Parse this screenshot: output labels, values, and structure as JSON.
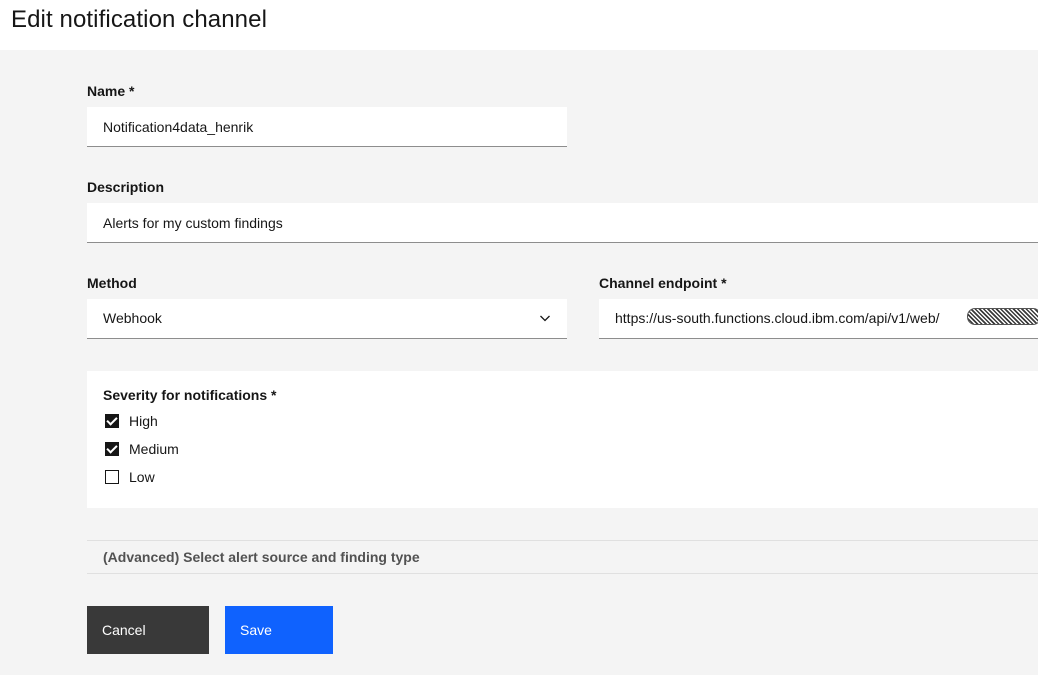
{
  "header": {
    "title": "Edit notification channel"
  },
  "form": {
    "name": {
      "label": "Name *",
      "value": "Notification4data_henrik"
    },
    "description": {
      "label": "Description",
      "value": "Alerts for my custom findings"
    },
    "method": {
      "label": "Method",
      "value": "Webhook"
    },
    "endpoint": {
      "label": "Channel endpoint *",
      "value": "https://us-south.functions.cloud.ibm.com/api/v1/web/"
    },
    "severity": {
      "label": "Severity for notifications *",
      "options": [
        {
          "label": "High",
          "checked": true
        },
        {
          "label": "Medium",
          "checked": true
        },
        {
          "label": "Low",
          "checked": false
        }
      ]
    },
    "advanced": {
      "label": "(Advanced) Select alert source and finding type"
    }
  },
  "actions": {
    "cancel_label": "Cancel",
    "save_label": "Save"
  },
  "colors": {
    "primary": "#0f62fe",
    "secondary": "#393939",
    "background": "#f4f4f4"
  }
}
